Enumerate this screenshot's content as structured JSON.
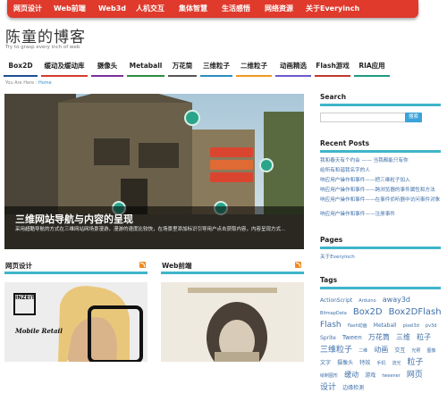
{
  "top_nav": [
    "网页设计",
    "Web前端",
    "Web3d",
    "人机交互",
    "集体智慧",
    "生活感悟",
    "网络资源",
    "关于Everyinch"
  ],
  "site": {
    "title": "陈童的博客",
    "tagline": "Try to grasp every inch of web"
  },
  "main_nav": [
    {
      "label": "Box2D",
      "color": "#1d4f91"
    },
    {
      "label": "缓动及缓动库",
      "color": "#d33a2c"
    },
    {
      "label": "摄像头",
      "color": "#7a2f9a"
    },
    {
      "label": "Metaball",
      "color": "#2e8b3e"
    },
    {
      "label": "万花筒",
      "color": "#555555"
    },
    {
      "label": "三维粒子",
      "color": "#2a8fbf"
    },
    {
      "label": "二维粒子",
      "color": "#f09a1e"
    },
    {
      "label": "动画精选",
      "color": "#6a5acd"
    },
    {
      "label": "Flash游戏",
      "color": "#c0392b"
    },
    {
      "label": "RIA应用",
      "color": "#1f9a80"
    }
  ],
  "breadcrumb": {
    "prefix": "You Are Here :",
    "home": "Home"
  },
  "slider": {
    "title": "三维网站导航与内容的呈现",
    "text": "采用超酷导航的方式在三维网站网场景漫游，漫游的速度比较快，在场景里添加标识引导用户点击获取内容，内容呈现方式..."
  },
  "sections": {
    "web_design": "网页设计",
    "web_front": "Web前端"
  },
  "thumb": {
    "brand": "INZEIT",
    "label": "Mobile Retail"
  },
  "sidebar": {
    "search_title": "Search",
    "search_button": "搜索",
    "recent_title": "Recent Posts",
    "recent": [
      "我和春天有个约会 —— 当我都能只有你",
      "给所有和谐我名字的人",
      "响应用户操作和事件——把三维粒子加入",
      "响应用户操作和事件——跨浏览器的事件属性和方法",
      "响应用户操作和事件——在事件侦听器中访问事件对象",
      "响应用户操作和事件——注册事件"
    ],
    "pages_title": "Pages",
    "pages": [
      "关于Everyinch"
    ],
    "tags_title": "Tags",
    "tags": [
      {
        "t": "ActionScript",
        "s": 6
      },
      {
        "t": "Arduino",
        "s": 5
      },
      {
        "t": "away3d",
        "s": 8
      },
      {
        "t": "BitmapData",
        "s": 5
      },
      {
        "t": "Box2D",
        "s": 10
      },
      {
        "t": "Box2DFlash",
        "s": 10
      },
      {
        "t": "Flash",
        "s": 9
      },
      {
        "t": "flash动画",
        "s": 5
      },
      {
        "t": "Metaball",
        "s": 6
      },
      {
        "t": "pixel3d",
        "s": 5
      },
      {
        "t": "pv3d",
        "s": 5
      },
      {
        "t": "Sprite",
        "s": 6
      },
      {
        "t": "Tween",
        "s": 7
      },
      {
        "t": "万花筒",
        "s": 8
      },
      {
        "t": "三维",
        "s": 8
      },
      {
        "t": "粒子",
        "s": 8
      },
      {
        "t": "三维粒子",
        "s": 9
      },
      {
        "t": "二维",
        "s": 5
      },
      {
        "t": "动画",
        "s": 8
      },
      {
        "t": "交互",
        "s": 6
      },
      {
        "t": "光照",
        "s": 5
      },
      {
        "t": "图像",
        "s": 5
      },
      {
        "t": "文字",
        "s": 6
      },
      {
        "t": "摄像头",
        "s": 6
      },
      {
        "t": "特效",
        "s": 6
      },
      {
        "t": "手机",
        "s": 5
      },
      {
        "t": "流光",
        "s": 5
      },
      {
        "t": "粒子",
        "s": 9
      },
      {
        "t": "绘制图形",
        "s": 5
      },
      {
        "t": "缓动",
        "s": 8
      },
      {
        "t": "游戏",
        "s": 6
      },
      {
        "t": "tweener",
        "s": 5
      },
      {
        "t": "网页",
        "s": 9
      },
      {
        "t": "设计",
        "s": 9
      },
      {
        "t": "边缘检测",
        "s": 6
      }
    ]
  },
  "colors": {
    "accent": "#df3a2c",
    "rule": "#3fb5c9",
    "link": "#3e6fa8"
  }
}
